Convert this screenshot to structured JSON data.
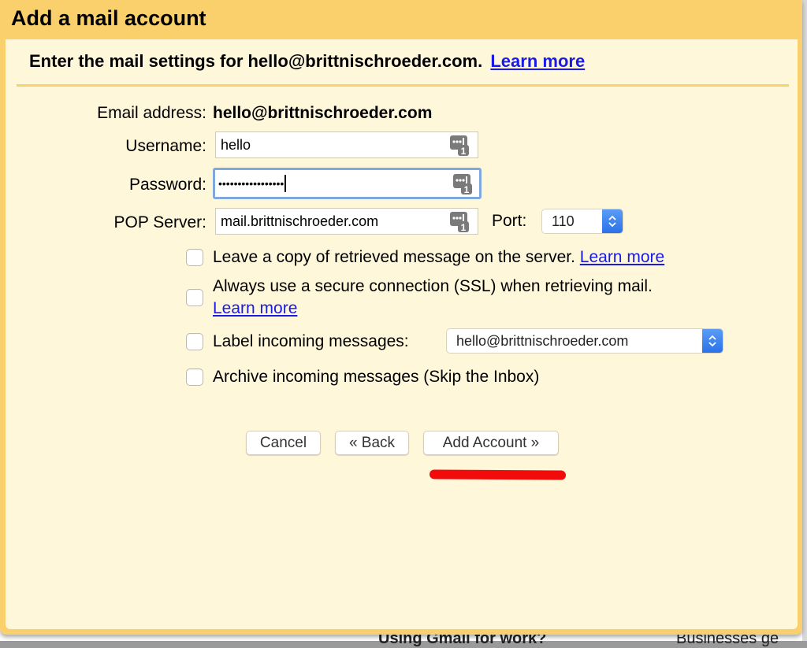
{
  "dialog": {
    "title": "Add a mail account",
    "intro_text": "Enter the mail settings for hello@brittnischroeder.com.",
    "intro_link": "Learn more"
  },
  "form": {
    "email_label": "Email address:",
    "email_value": "hello@brittnischroeder.com",
    "username_label": "Username:",
    "username_value": "hello",
    "password_label": "Password:",
    "password_value": "•••••••••••••••••",
    "pop_server_label": "POP Server:",
    "pop_server_value": "mail.brittnischroeder.com",
    "port_label": "Port:",
    "port_value": "110",
    "password_manager_icon": "password-manager-icon"
  },
  "options": [
    {
      "label": "Leave a copy of retrieved message on the server.",
      "link": "Learn more",
      "checked": false
    },
    {
      "label": "Always use a secure connection (SSL) when retrieving mail.",
      "link": "Learn more",
      "checked": false
    },
    {
      "label": "Label incoming messages:",
      "select_value": "hello@brittnischroeder.com",
      "checked": false
    },
    {
      "label": "Archive incoming messages (Skip the Inbox)",
      "checked": false
    }
  ],
  "buttons": {
    "cancel": "Cancel",
    "back": "« Back",
    "add_account": "Add Account »"
  },
  "background": {
    "text_left": "Using Gmail for work?",
    "text_right": "Businesses ge"
  },
  "colors": {
    "header": "#fad06c",
    "body": "#fff7da",
    "link": "#1a1ae6",
    "focus": "#7fa8de",
    "annotation": "#f20b0b"
  }
}
